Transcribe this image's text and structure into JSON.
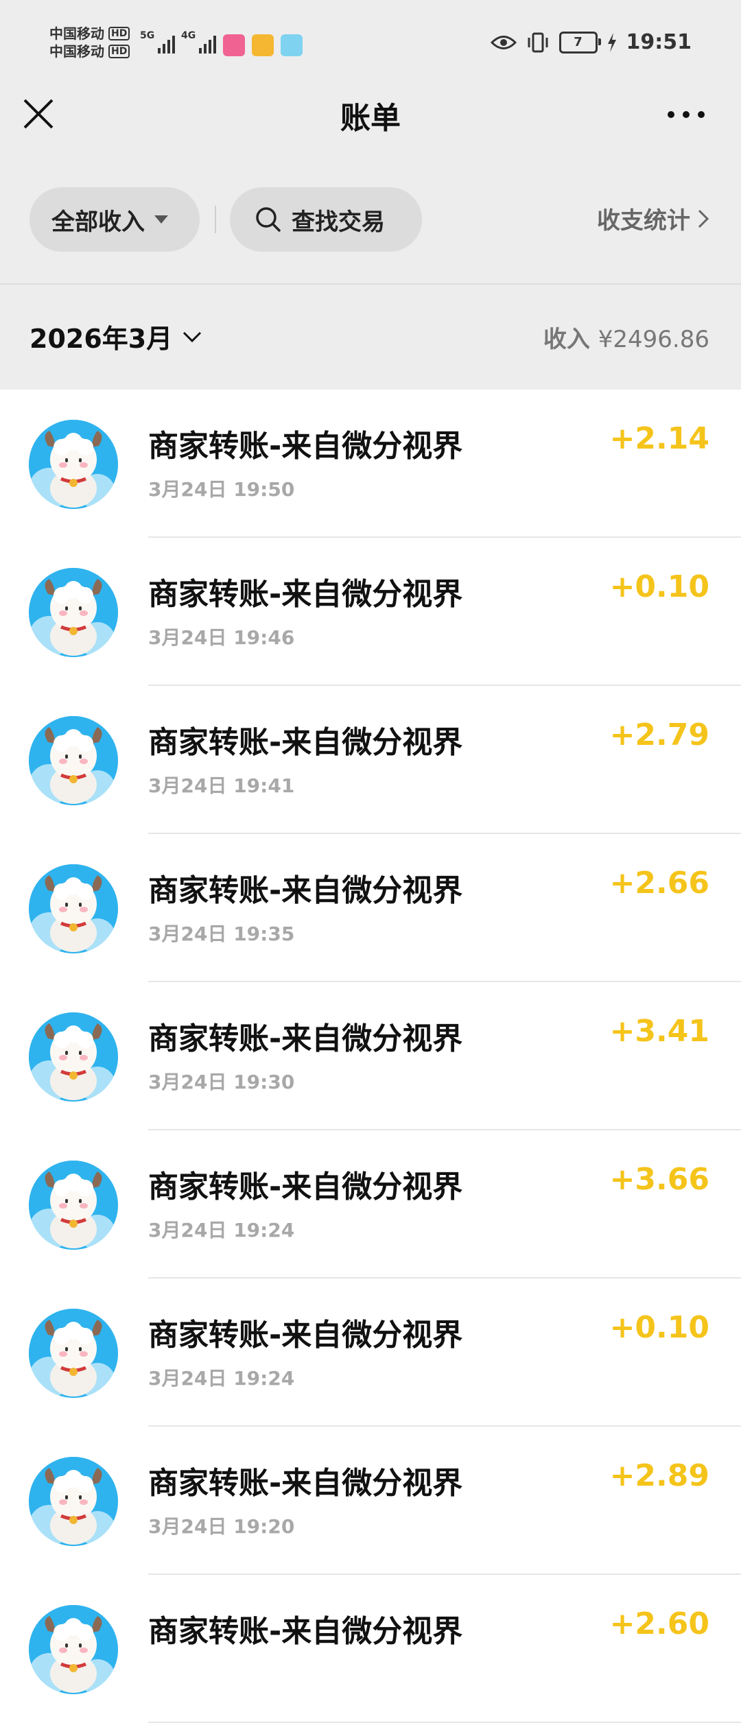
{
  "status_bar": {
    "carrier_1": "中国移动",
    "carrier_2": "中国移动",
    "hd_badge": "HD",
    "network_1": "5G",
    "network_2": "4G",
    "battery": "7",
    "time": "19:51"
  },
  "header": {
    "title": "账单"
  },
  "filters": {
    "all_income": "全部收入",
    "search": "查找交易",
    "stats": "收支统计"
  },
  "summary": {
    "month": "2026年3月",
    "income_label": "收入",
    "income_amount": "¥2496.86"
  },
  "transactions": [
    {
      "title": "商家转账-来自微分视界",
      "time": "3月24日  19:50",
      "amount": "+2.14"
    },
    {
      "title": "商家转账-来自微分视界",
      "time": "3月24日  19:46",
      "amount": "+0.10"
    },
    {
      "title": "商家转账-来自微分视界",
      "time": "3月24日  19:41",
      "amount": "+2.79"
    },
    {
      "title": "商家转账-来自微分视界",
      "time": "3月24日  19:35",
      "amount": "+2.66"
    },
    {
      "title": "商家转账-来自微分视界",
      "time": "3月24日  19:30",
      "amount": "+3.41"
    },
    {
      "title": "商家转账-来自微分视界",
      "time": "3月24日  19:24",
      "amount": "+3.66"
    },
    {
      "title": "商家转账-来自微分视界",
      "time": "3月24日  19:24",
      "amount": "+0.10"
    },
    {
      "title": "商家转账-来自微分视界",
      "time": "3月24日  19:20",
      "amount": "+2.89"
    },
    {
      "title": "商家转账-来自微分视界",
      "time": "",
      "amount": "+2.60"
    }
  ],
  "colors": {
    "amount": "#f5c41b",
    "background_top": "#ededed",
    "pill": "#dcdcdc"
  }
}
